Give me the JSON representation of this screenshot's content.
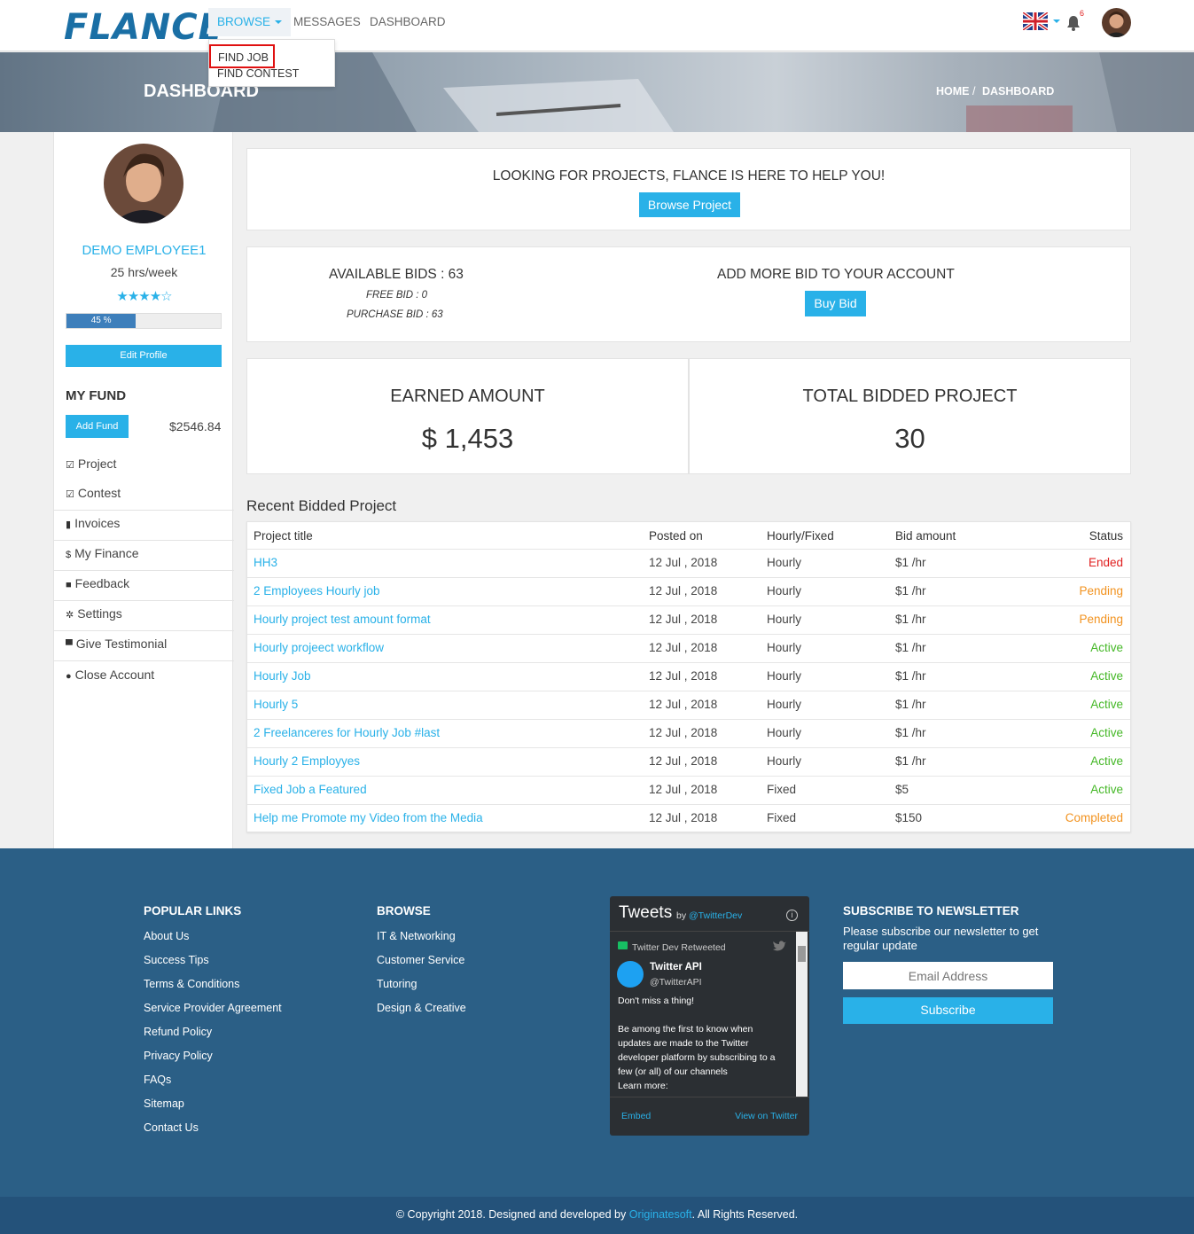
{
  "header": {
    "logo": "FLANCE",
    "nav": {
      "browse": "BROWSE",
      "messages": "MESSAGES",
      "dashboard": "DASHBOARD"
    },
    "notification_count": "6",
    "dropdown": {
      "find_job": "FIND JOB",
      "find_contest": "FIND CONTEST"
    }
  },
  "hero": {
    "title": "DASHBOARD",
    "breadcrumb": [
      "HOME",
      "/",
      "DASHBOARD"
    ]
  },
  "sidebar": {
    "name": "DEMO EMPLOYEE1",
    "hours": "25 hrs/week",
    "stars": "★★★★☆",
    "progress_label": "45 %",
    "progress_value": 0.45,
    "edit_profile": "Edit Profile",
    "fund_title": "MY FUND",
    "add_fund": "Add Fund",
    "fund_amount": "$2546.84",
    "items": [
      {
        "icon": "checkbox-icon",
        "label": "Project"
      },
      {
        "icon": "checkbox-icon",
        "label": "Contest"
      },
      {
        "icon": "file-icon",
        "label": "Invoices"
      },
      {
        "icon": "dollar-icon",
        "label": "My Finance"
      },
      {
        "icon": "comment-icon",
        "label": "Feedback"
      },
      {
        "icon": "gear-icon",
        "label": "Settings"
      },
      {
        "icon": "comments-icon",
        "label": "Give Testimonial"
      },
      {
        "icon": "user-icon",
        "label": "Close Account"
      }
    ]
  },
  "promo": {
    "title": "LOOKING FOR PROJECTS, FLANCE IS HERE TO HELP YOU!",
    "button": "Browse Project"
  },
  "bids": {
    "available": "AVAILABLE BIDS : 63",
    "free": "FREE BID : 0",
    "purchase": "PURCHASE BID : 63",
    "add_more": "ADD MORE BID TO YOUR ACCOUNT",
    "buy_button": "Buy Bid"
  },
  "stats": {
    "earned_label": "EARNED AMOUNT",
    "earned_value": "$ 1,453",
    "bidded_label": "TOTAL BIDDED PROJECT",
    "bidded_value": "30"
  },
  "recent": {
    "title": "Recent Bidded Project",
    "columns": [
      "Project title",
      "Posted on",
      "Hourly/Fixed",
      "Bid amount",
      "Status"
    ],
    "rows": [
      {
        "title": "HH3",
        "posted": "12 Jul , 2018",
        "type": "Hourly",
        "bid": "$1 /hr",
        "status": "Ended"
      },
      {
        "title": "2 Employees Hourly job",
        "posted": "12 Jul , 2018",
        "type": "Hourly",
        "bid": "$1 /hr",
        "status": "Pending"
      },
      {
        "title": "Hourly project test amount format",
        "posted": "12 Jul , 2018",
        "type": "Hourly",
        "bid": "$1 /hr",
        "status": "Pending"
      },
      {
        "title": "Hourly projeect workflow",
        "posted": "12 Jul , 2018",
        "type": "Hourly",
        "bid": "$1 /hr",
        "status": "Active"
      },
      {
        "title": "Hourly Job",
        "posted": "12 Jul , 2018",
        "type": "Hourly",
        "bid": "$1 /hr",
        "status": "Active"
      },
      {
        "title": "Hourly 5",
        "posted": "12 Jul , 2018",
        "type": "Hourly",
        "bid": "$1 /hr",
        "status": "Active"
      },
      {
        "title": "2 Freelanceres for Hourly Job #last",
        "posted": "12 Jul , 2018",
        "type": "Hourly",
        "bid": "$1 /hr",
        "status": "Active"
      },
      {
        "title": "Hourly 2 Employyes",
        "posted": "12 Jul , 2018",
        "type": "Hourly",
        "bid": "$1 /hr",
        "status": "Active"
      },
      {
        "title": "Fixed Job a Featured",
        "posted": "12 Jul , 2018",
        "type": "Fixed",
        "bid": "$5",
        "status": "Active"
      },
      {
        "title": "Help me Promote my Video from the Media",
        "posted": "12 Jul , 2018",
        "type": "Fixed",
        "bid": "$150",
        "status": "Completed"
      }
    ]
  },
  "footer": {
    "popular_title": "POPULAR LINKS",
    "popular_links": [
      "About Us",
      "Success Tips",
      "Terms & Conditions",
      "Service Provider Agreement",
      "Refund Policy",
      "Privacy Policy",
      "FAQs",
      "Sitemap",
      "Contact Us"
    ],
    "browse_title": "BROWSE",
    "browse_links": [
      "IT & Networking",
      "Customer Service",
      "Tutoring",
      "Design & Creative"
    ],
    "tweets": {
      "title": "Tweets",
      "by": "by",
      "handle": "@TwitterDev",
      "retweeted": "Twitter Dev Retweeted",
      "account_name": "Twitter API",
      "account_handle": "@TwitterAPI",
      "line1": "Don't miss a thing!",
      "body": [
        "Be among the first to know when",
        "updates are made to the Twitter",
        "developer platform by subscribing to a",
        "few (or all) of our channels",
        "Learn more:"
      ],
      "embed": "Embed",
      "view": "View on Twitter"
    },
    "subscribe_title": "SUBSCRIBE TO NEWSLETTER",
    "subscribe_text": "Please subscribe our newsletter to get regular update",
    "email_placeholder": "Email Address",
    "subscribe_button": "Subscribe",
    "copyright_pre": "© Copyright 2018. Designed and developed by",
    "copyright_brand": "Originatesoft",
    "copyright_post": ". All Rights Reserved."
  },
  "colors": {
    "accent": "#29b1e8",
    "footer": "#2b5f86",
    "ended": "#e02020",
    "pending": "#f29320",
    "active": "#45b827"
  }
}
